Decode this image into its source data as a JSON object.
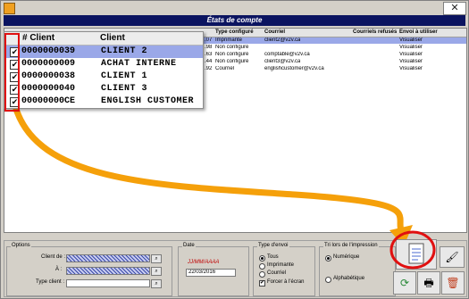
{
  "window": {
    "title": "États de compte",
    "close_glyph": "✕"
  },
  "grid": {
    "columns": [
      "Type configuré",
      "Courriel",
      "Courriels refusés",
      "Envoi à utiliser"
    ],
    "rows": [
      {
        "amt": ".07",
        "type": "Imprimante",
        "email": "client2@v2v.ca",
        "refused": "",
        "send": "Visualiser",
        "selected": true
      },
      {
        "amt": ".98",
        "type": "Non configuré",
        "email": "",
        "refused": "",
        "send": "Visualiser",
        "selected": false
      },
      {
        "amt": ".63",
        "type": "Non configuré",
        "email": "comptable@v2v.ca",
        "refused": "",
        "send": "Visualiser",
        "selected": false
      },
      {
        "amt": ".44",
        "type": "Non configuré",
        "email": "client3@v2v.ca",
        "refused": "",
        "send": "Visualiser",
        "selected": false
      },
      {
        "amt": ".92",
        "type": "Courriel",
        "email": "englishcustomer@v2v.ca",
        "refused": "",
        "send": "Visualiser",
        "selected": false
      }
    ]
  },
  "popup": {
    "headers": [
      "# Client",
      "Client"
    ],
    "rows": [
      {
        "num": "0000000039",
        "name": "CLIENT 2",
        "checked": true,
        "selected": true
      },
      {
        "num": "0000000009",
        "name": "ACHAT INTERNE",
        "checked": true,
        "selected": false
      },
      {
        "num": "0000000038",
        "name": "CLIENT 1",
        "checked": true,
        "selected": false
      },
      {
        "num": "0000000040",
        "name": "CLIENT 3",
        "checked": true,
        "selected": false
      },
      {
        "num": "00000000CE",
        "name": "ENGLISH CUSTOMER",
        "checked": true,
        "selected": false
      }
    ],
    "check_glyph": "✔"
  },
  "options": {
    "group_label": "Options",
    "client_from_label": "Client de :",
    "to_label": "À :",
    "client_type_label": "Type client :"
  },
  "date": {
    "group_label": "Date",
    "format_hint": "JJ/MM/AAAA",
    "value": "22/03/2016"
  },
  "send_type": {
    "group_label": "Type d'envoi",
    "options": [
      "Tous",
      "Imprimante",
      "Courriel",
      "Forcer à l'écran"
    ],
    "selected": "Tous",
    "force_checked": true
  },
  "sort": {
    "group_label": "Tri lors de l'impression",
    "options": [
      "Numérique",
      "Alphabétique"
    ],
    "selected": "Numérique"
  },
  "colors": {
    "title_bg": "#0b1460",
    "selection": "#9aa8e8",
    "arrow": "#f5a00a",
    "highlight": "#e01010"
  },
  "icons": [
    "document-icon",
    "brush-icon",
    "refresh-icon",
    "printer-icon",
    "trash-icon"
  ]
}
